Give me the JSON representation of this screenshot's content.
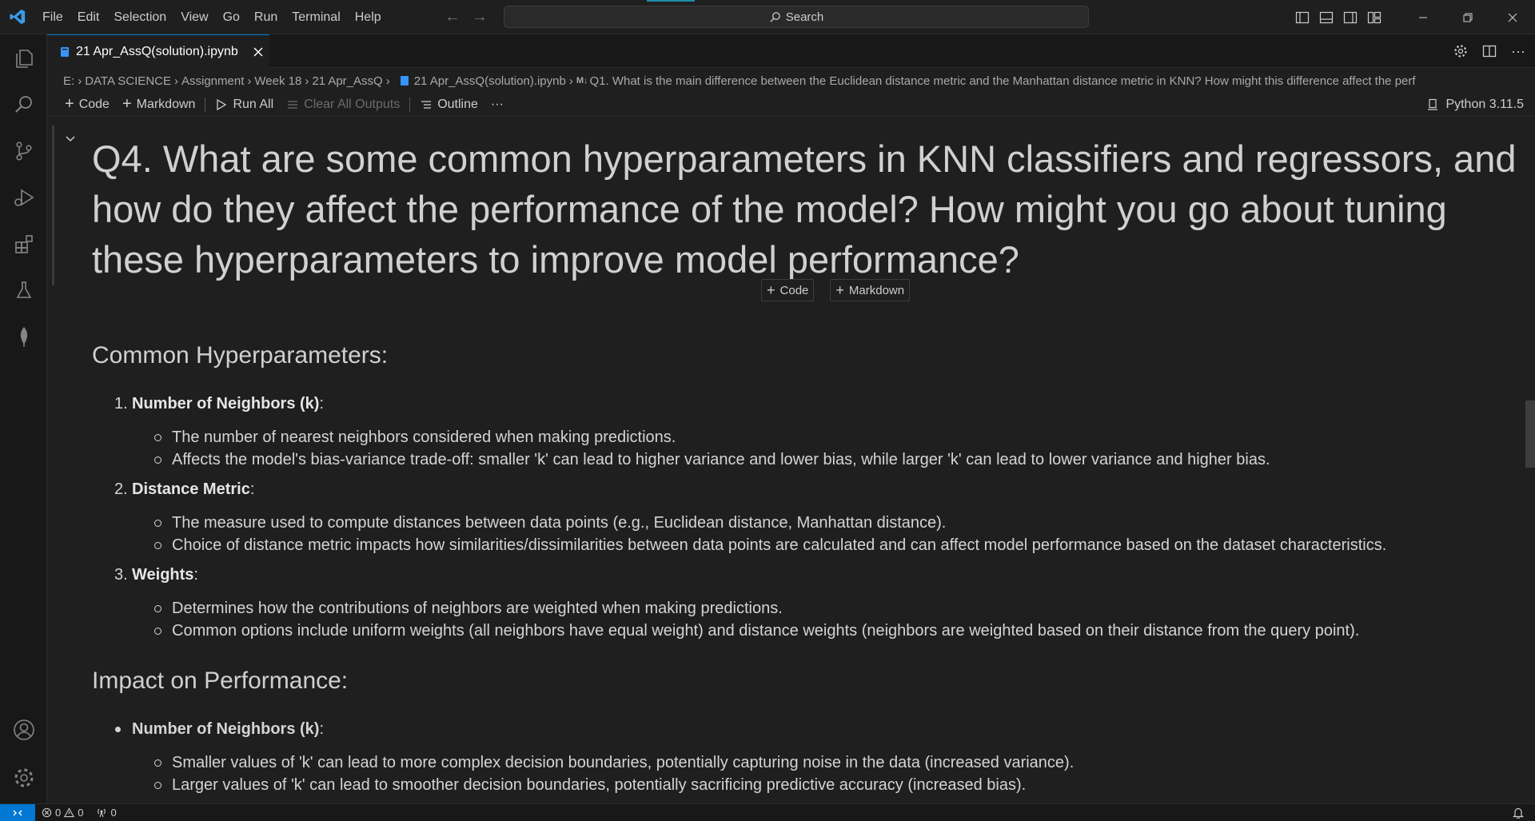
{
  "menu": [
    "File",
    "Edit",
    "Selection",
    "View",
    "Go",
    "Run",
    "Terminal",
    "Help"
  ],
  "search": {
    "label": "Search"
  },
  "tab": {
    "title": "21 Apr_AssQ(solution).ipynb"
  },
  "breadcrumb": [
    "E:",
    "DATA SCIENCE",
    "Assignment",
    "Week 18",
    "21 Apr_AssQ",
    "21 Apr_AssQ(solution).ipynb",
    "Q1. What is the main difference between the Euclidean distance metric and the Manhattan distance metric in KNN? How might this difference affect the perf"
  ],
  "toolbar": {
    "code": "Code",
    "markdown": "Markdown",
    "run_all": "Run All",
    "clear_outputs": "Clear All Outputs",
    "outline": "Outline",
    "more": "···",
    "kernel": "Python 3.11.5"
  },
  "cell": {
    "title": "Q4. What are some common hyperparameters in KNN classifiers and regressors, and how do they affect the performance of the model? How might you go about tuning these hyperparameters to improve model performance?",
    "insert_code": "Code",
    "insert_markdown": "Markdown"
  },
  "content": {
    "heading1": "Common Hyperparameters:",
    "items": [
      {
        "num": "1.",
        "label": "Number of Neighbors (k)",
        "bullets": [
          "The number of nearest neighbors considered when making predictions.",
          "Affects the model's bias-variance trade-off: smaller 'k' can lead to higher variance and lower bias, while larger 'k' can lead to lower variance and higher bias."
        ]
      },
      {
        "num": "2.",
        "label": "Distance Metric",
        "bullets": [
          "The measure used to compute distances between data points (e.g., Euclidean distance, Manhattan distance).",
          "Choice of distance metric impacts how similarities/dissimilarities between data points are calculated and can affect model performance based on the dataset characteristics."
        ]
      },
      {
        "num": "3.",
        "label": "Weights",
        "bullets": [
          "Determines how the contributions of neighbors are weighted when making predictions.",
          "Common options include uniform weights (all neighbors have equal weight) and distance weights (neighbors are weighted based on their distance from the query point)."
        ]
      }
    ],
    "heading2": "Impact on Performance:",
    "impact_item": {
      "label": "Number of Neighbors (k)",
      "bullets": [
        "Smaller values of 'k' can lead to more complex decision boundaries, potentially capturing noise in the data (increased variance).",
        "Larger values of 'k' can lead to smoother decision boundaries, potentially sacrificing predictive accuracy (increased bias)."
      ]
    }
  },
  "status": {
    "errors": "0",
    "warnings": "0",
    "ports": "0"
  },
  "colors": {
    "accent": "#0078d4",
    "background": "#1f1f1f",
    "sidebar": "#181818"
  }
}
